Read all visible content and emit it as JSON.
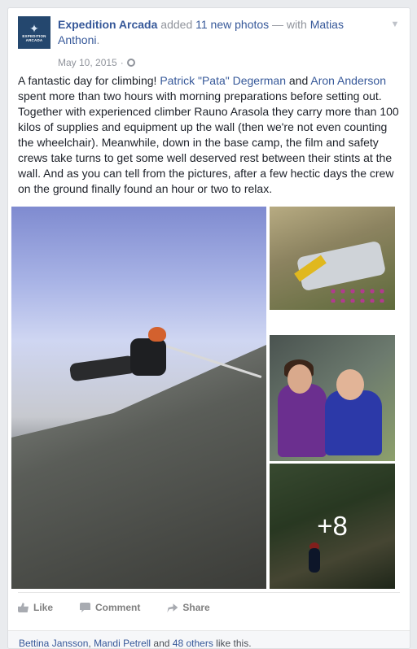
{
  "post": {
    "page_name": "Expedition Arcada",
    "avatar_text": "EXPEDITION ARCADA",
    "verb": "added",
    "photo_count_text": "11 new photos",
    "with_text": "— with",
    "tagged_name": "Matias Anthoni",
    "trailing_period": ".",
    "date": "May 10, 2015",
    "date_separator": "·",
    "privacy_icon": "globe-icon",
    "menu_icon": "chevron-down-icon"
  },
  "body": {
    "part1": "A fantastic day for climbing! ",
    "link1": "Patrick \"Pata\" Degerman",
    "part2": " and ",
    "link2": "Aron Anderson",
    "part3": " spent more than two hours with morning preparations before setting out. Together with experienced climber Rauno Arasola they carry more than 100 kilos of supplies and equipment up the wall (then we're not even counting the wheelchair). Meanwhile, down in the base camp, the film and safety crews take turns to get some well deserved rest between their stints at the wall. And as you can tell from the pictures, after a few hectic days the crew on the ground finally found an hour or two to relax."
  },
  "photos": {
    "more_count": "+8"
  },
  "actions": {
    "like": "Like",
    "comment": "Comment",
    "share": "Share"
  },
  "likes": {
    "name1": "Bettina Jansson",
    "sep": ", ",
    "name2": "Mandi Petrell",
    "and": " and ",
    "others": "48 others",
    "suffix": " like this."
  },
  "colors": {
    "link": "#365899",
    "meta": "#90949c",
    "text": "#1d2129"
  }
}
